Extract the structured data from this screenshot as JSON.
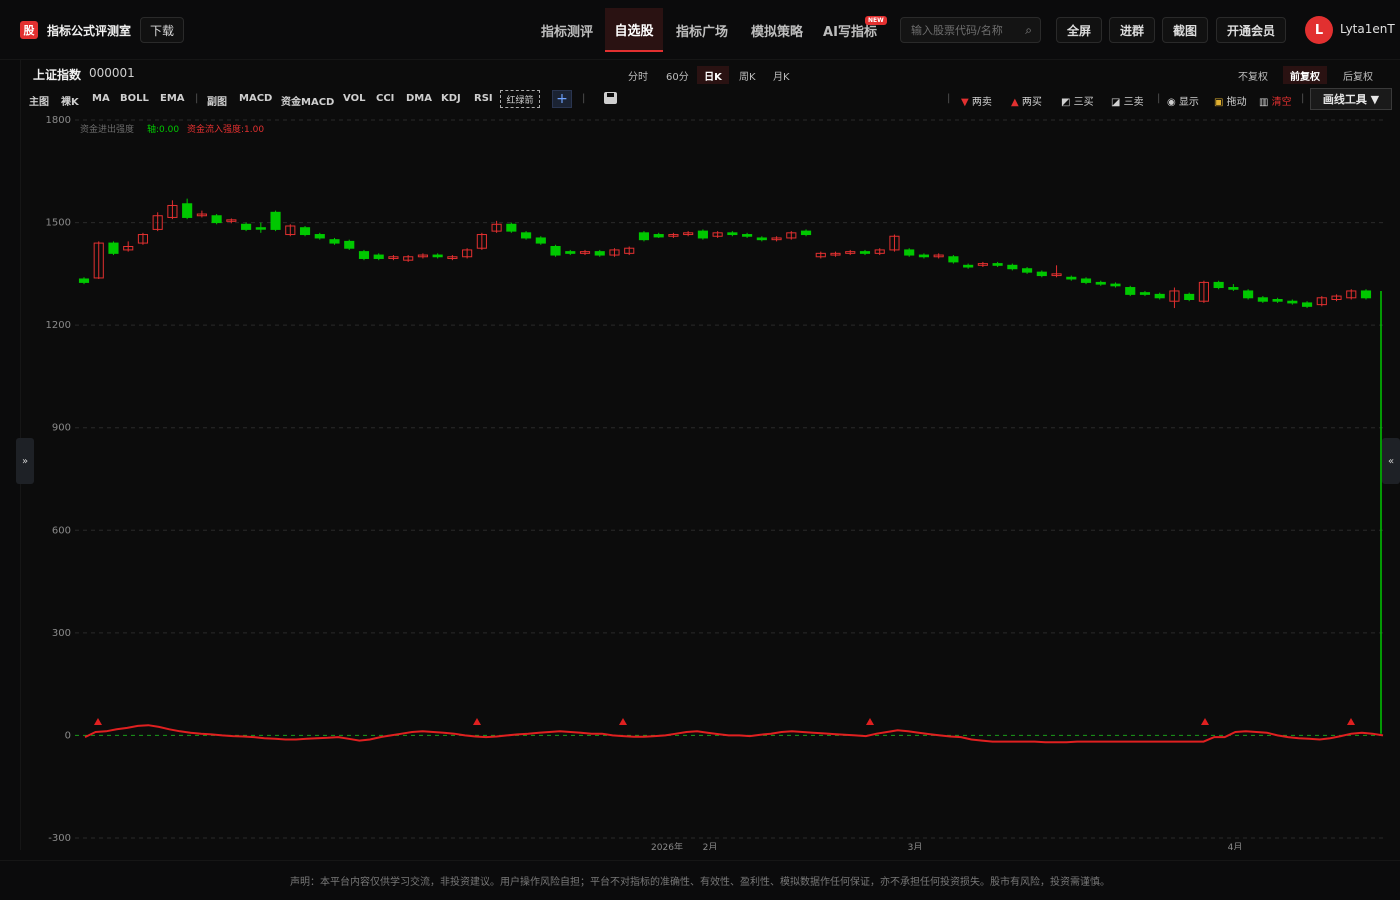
{
  "app": {
    "logo_char": "股",
    "title": "指标公式评测室",
    "download": "下载"
  },
  "nav": {
    "tabs": [
      "指标测评",
      "自选股",
      "指标广场",
      "模拟策略",
      "AI写指标"
    ],
    "active": "自选股",
    "new_badge": "NEW"
  },
  "search": {
    "placeholder": "输入股票代码/名称"
  },
  "top_buttons": [
    "全屏",
    "进群",
    "截图",
    "开通会员"
  ],
  "user": {
    "avatar_char": "L",
    "name": "Lyta1enT"
  },
  "stock": {
    "name": "上证指数",
    "code": "000001"
  },
  "periods": [
    "分时",
    "60分",
    "日K",
    "周K",
    "月K"
  ],
  "period_active": "日K",
  "adjust": [
    "不复权",
    "前复权",
    "后复权"
  ],
  "adjust_active": "前复权",
  "main_indicators": [
    "主图",
    "裸K",
    "MA",
    "BOLL",
    "EMA"
  ],
  "sub_indicators": [
    "副图",
    "MACD",
    "资金MACD",
    "VOL",
    "CCI",
    "DMA",
    "KDJ",
    "RSI"
  ],
  "active_indicator": "红绿箭",
  "plus": "+",
  "tools": {
    "sell2": "两卖",
    "buy2": "两买",
    "buy3": "三买",
    "sell3": "三卖",
    "show": "显示",
    "drag": "拖动",
    "clear": "清空",
    "draw": "画线工具 ▼"
  },
  "legend": {
    "title": "资金进出强度",
    "axis": "轴:0.00",
    "inflow": "资金流入强度:1.00"
  },
  "side": {
    "left": "»",
    "right": "«"
  },
  "disclaimer": "声明：本平台内容仅供学习交流，非投资建议。用户操作风险自担；平台不对指标的准确性、有效性、盈利性、模拟数据作任何保证，亦不承担任何投资损失。股市有风险，投资需谨慎。",
  "colors": {
    "up": "#e23030",
    "down": "#00c800",
    "accent": "#e23030"
  },
  "chart_data": {
    "type": "candlestick",
    "yticks": [
      1800,
      1500,
      1200,
      900,
      600,
      300,
      0,
      -300
    ],
    "ylim": [
      -300,
      1800
    ],
    "xlabels": [
      "2026年",
      "2月",
      "3月",
      "4月"
    ],
    "candles": [
      [
        1335,
        1325,
        1340,
        1320
      ],
      [
        1338,
        1440,
        1445,
        1335
      ],
      [
        1440,
        1410,
        1445,
        1405
      ],
      [
        1420,
        1430,
        1445,
        1415
      ],
      [
        1440,
        1465,
        1470,
        1435
      ],
      [
        1480,
        1520,
        1530,
        1475
      ],
      [
        1515,
        1550,
        1565,
        1510
      ],
      [
        1555,
        1515,
        1570,
        1510
      ],
      [
        1520,
        1525,
        1535,
        1515
      ],
      [
        1520,
        1500,
        1525,
        1495
      ],
      [
        1505,
        1508,
        1512,
        1498
      ],
      [
        1495,
        1480,
        1500,
        1475
      ],
      [
        1485,
        1484,
        1500,
        1470
      ],
      [
        1530,
        1480,
        1535,
        1475
      ],
      [
        1465,
        1490,
        1495,
        1460
      ],
      [
        1485,
        1465,
        1490,
        1460
      ],
      [
        1465,
        1455,
        1470,
        1450
      ],
      [
        1450,
        1440,
        1455,
        1435
      ],
      [
        1445,
        1425,
        1450,
        1420
      ],
      [
        1415,
        1395,
        1420,
        1390
      ],
      [
        1405,
        1395,
        1410,
        1390
      ],
      [
        1395,
        1400,
        1405,
        1390
      ],
      [
        1390,
        1400,
        1405,
        1385
      ],
      [
        1400,
        1405,
        1410,
        1395
      ],
      [
        1405,
        1400,
        1410,
        1395
      ],
      [
        1395,
        1400,
        1405,
        1390
      ],
      [
        1400,
        1420,
        1425,
        1395
      ],
      [
        1425,
        1465,
        1470,
        1420
      ],
      [
        1475,
        1495,
        1505,
        1470
      ],
      [
        1495,
        1475,
        1500,
        1470
      ],
      [
        1470,
        1455,
        1475,
        1450
      ],
      [
        1455,
        1440,
        1460,
        1435
      ],
      [
        1430,
        1405,
        1435,
        1400
      ],
      [
        1415,
        1410,
        1420,
        1405
      ],
      [
        1410,
        1415,
        1420,
        1405
      ],
      [
        1415,
        1405,
        1420,
        1400
      ],
      [
        1405,
        1420,
        1425,
        1400
      ],
      [
        1410,
        1425,
        1430,
        1405
      ],
      [
        1470,
        1450,
        1475,
        1445
      ],
      [
        1465,
        1458,
        1470,
        1455
      ],
      [
        1460,
        1465,
        1470,
        1455
      ],
      [
        1465,
        1470,
        1475,
        1460
      ],
      [
        1475,
        1455,
        1480,
        1450
      ],
      [
        1460,
        1470,
        1475,
        1455
      ],
      [
        1470,
        1465,
        1475,
        1460
      ],
      [
        1465,
        1460,
        1470,
        1455
      ],
      [
        1455,
        1450,
        1460,
        1445
      ],
      [
        1450,
        1455,
        1460,
        1445
      ],
      [
        1455,
        1470,
        1475,
        1450
      ],
      [
        1475,
        1465,
        1480,
        1460
      ],
      [
        1400,
        1410,
        1415,
        1395
      ],
      [
        1405,
        1410,
        1415,
        1400
      ],
      [
        1410,
        1415,
        1420,
        1405
      ],
      [
        1415,
        1410,
        1420,
        1405
      ],
      [
        1410,
        1420,
        1425,
        1405
      ],
      [
        1420,
        1460,
        1465,
        1415
      ],
      [
        1420,
        1405,
        1425,
        1400
      ],
      [
        1405,
        1400,
        1410,
        1395
      ],
      [
        1400,
        1405,
        1410,
        1395
      ],
      [
        1400,
        1385,
        1405,
        1380
      ],
      [
        1375,
        1370,
        1380,
        1365
      ],
      [
        1375,
        1380,
        1385,
        1370
      ],
      [
        1380,
        1375,
        1385,
        1370
      ],
      [
        1375,
        1365,
        1380,
        1360
      ],
      [
        1365,
        1355,
        1370,
        1350
      ],
      [
        1355,
        1345,
        1360,
        1340
      ],
      [
        1345,
        1350,
        1375,
        1340
      ],
      [
        1340,
        1335,
        1345,
        1330
      ],
      [
        1335,
        1325,
        1340,
        1320
      ],
      [
        1325,
        1320,
        1330,
        1315
      ],
      [
        1320,
        1315,
        1325,
        1310
      ],
      [
        1310,
        1290,
        1315,
        1285
      ],
      [
        1295,
        1290,
        1300,
        1285
      ],
      [
        1290,
        1280,
        1295,
        1275
      ],
      [
        1270,
        1300,
        1310,
        1250
      ],
      [
        1290,
        1275,
        1295,
        1270
      ],
      [
        1270,
        1325,
        1330,
        1265
      ],
      [
        1325,
        1310,
        1330,
        1305
      ],
      [
        1310,
        1305,
        1320,
        1300
      ],
      [
        1300,
        1280,
        1305,
        1275
      ],
      [
        1280,
        1270,
        1285,
        1265
      ],
      [
        1275,
        1270,
        1280,
        1265
      ],
      [
        1270,
        1265,
        1275,
        1260
      ],
      [
        1265,
        1255,
        1270,
        1250
      ],
      [
        1260,
        1280,
        1285,
        1255
      ],
      [
        1275,
        1285,
        1290,
        1270
      ],
      [
        1280,
        1300,
        1305,
        1275
      ],
      [
        1300,
        1280,
        1305,
        1275
      ]
    ],
    "indicator_line": [
      -5,
      10,
      12,
      18,
      22,
      28,
      30,
      25,
      18,
      12,
      8,
      5,
      3,
      0,
      -2,
      -3,
      -5,
      -8,
      -10,
      -12,
      -12,
      -10,
      -8,
      -7,
      -5,
      -10,
      -15,
      -12,
      -5,
      0,
      5,
      10,
      12,
      10,
      8,
      5,
      0,
      -3,
      -5,
      -3,
      0,
      3,
      5,
      8,
      10,
      12,
      10,
      8,
      5,
      5,
      0,
      -2,
      -4,
      -4,
      -2,
      0,
      5,
      10,
      12,
      8,
      4,
      0,
      0,
      -2,
      2,
      5,
      10,
      12,
      10,
      8,
      6,
      4,
      2,
      0,
      -2,
      5,
      10,
      15,
      12,
      8,
      4,
      0,
      -3,
      -5,
      -12,
      -15,
      -18,
      -18,
      -18,
      -18,
      -18,
      -20,
      -20,
      -20,
      -18,
      -18,
      -18,
      -18,
      -18,
      -18,
      -18,
      -18,
      -18,
      -18,
      -18,
      -18,
      -18,
      -5,
      -5,
      10,
      12,
      10,
      8,
      0,
      -5,
      -8,
      -10,
      -12,
      -8,
      -2,
      5,
      8,
      5,
      0
    ],
    "triangles": [
      98,
      477,
      623,
      870,
      1205,
      1351
    ]
  }
}
